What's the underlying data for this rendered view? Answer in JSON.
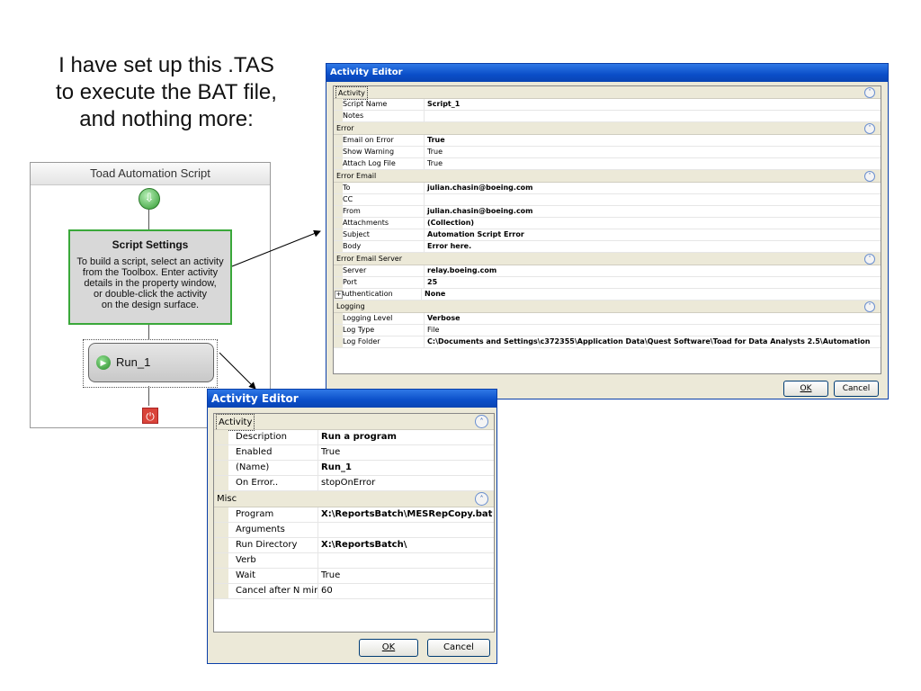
{
  "caption": {
    "lines": [
      "I have set up this .TAS",
      "to execute the BAT file,",
      "and nothing more:"
    ]
  },
  "tas": {
    "header": "Toad Automation Script",
    "settings_title": "Script Settings",
    "settings_lines": [
      "To build a script, select an activity",
      "from the Toolbox. Enter activity",
      "details in the property window,",
      "or double-click the activity",
      "on the design surface."
    ],
    "run_label": "Run_1"
  },
  "big_editor": {
    "title": "Activity Editor",
    "categories": [
      {
        "label": "Activity",
        "rows": [
          {
            "name": "Script Name",
            "value": "Script_1",
            "bold": true
          },
          {
            "name": "Notes",
            "value": "",
            "bold": false
          }
        ]
      },
      {
        "label": "Error",
        "rows": [
          {
            "name": "Email on Error",
            "value": "True",
            "bold": true
          },
          {
            "name": "Show Warning",
            "value": "True",
            "bold": false
          },
          {
            "name": "Attach Log File",
            "value": "True",
            "bold": false
          }
        ]
      },
      {
        "label": "Error Email",
        "rows": [
          {
            "name": "To",
            "value": "julian.chasin@boeing.com",
            "bold": true
          },
          {
            "name": "CC",
            "value": "",
            "bold": false
          },
          {
            "name": "From",
            "value": "julian.chasin@boeing.com",
            "bold": true
          },
          {
            "name": "Attachments",
            "value": "(Collection)",
            "bold": true
          },
          {
            "name": "Subject",
            "value": "Automation Script Error",
            "bold": true
          },
          {
            "name": "Body",
            "value": "Error here.",
            "bold": true
          }
        ]
      },
      {
        "label": "Error Email Server",
        "rows": [
          {
            "name": "Server",
            "value": "relay.boeing.com",
            "bold": true
          },
          {
            "name": "Port",
            "value": "25",
            "bold": true
          },
          {
            "name": "Authentication",
            "value": "None",
            "bold": true,
            "expandable": true
          }
        ]
      },
      {
        "label": "Logging",
        "rows": [
          {
            "name": "Logging Level",
            "value": "Verbose",
            "bold": true
          },
          {
            "name": "Log Type",
            "value": "File",
            "bold": false
          },
          {
            "name": "Log Folder",
            "value": "C:\\Documents and Settings\\c372355\\Application Data\\Quest Software\\Toad for Data Analysts 2.5\\Automation",
            "bold": true
          }
        ]
      }
    ],
    "ok_label": "OK",
    "cancel_label": "Cancel"
  },
  "small_editor": {
    "title": "Activity Editor",
    "categories": [
      {
        "label": "Activity",
        "rows": [
          {
            "name": "Description",
            "value": "Run a program",
            "bold": true
          },
          {
            "name": "Enabled",
            "value": "True",
            "bold": false
          },
          {
            "name": "(Name)",
            "value": "Run_1",
            "bold": true
          },
          {
            "name": "On Error..",
            "value": "stopOnError",
            "bold": false
          }
        ]
      },
      {
        "label": "Misc",
        "rows": [
          {
            "name": "Program",
            "value": "X:\\ReportsBatch\\MESRepCopy.bat",
            "bold": true
          },
          {
            "name": "Arguments",
            "value": "",
            "bold": false
          },
          {
            "name": "Run Directory",
            "value": "X:\\ReportsBatch\\",
            "bold": true
          },
          {
            "name": "Verb",
            "value": "",
            "bold": false
          },
          {
            "name": "Wait",
            "value": "True",
            "bold": false
          },
          {
            "name": "Cancel after N minut",
            "value": "60",
            "bold": false
          }
        ]
      }
    ],
    "ok_label": "OK",
    "cancel_label": "Cancel"
  },
  "icons": {
    "start": "start-arrow-icon",
    "run": "run-play-icon",
    "stop": "stop-power-icon",
    "collapse": "collapse-chevron-icon",
    "expand": "expand-plus-icon"
  },
  "colors": {
    "title_bar": "#0a4ec8",
    "settings_border": "#3aa83a",
    "stop": "#d9443a"
  }
}
